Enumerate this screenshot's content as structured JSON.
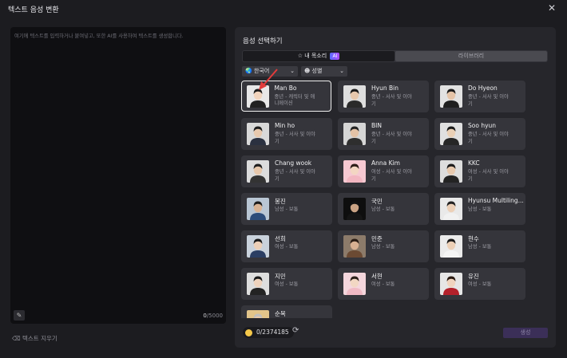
{
  "window": {
    "title": "텍스트 음성 변환",
    "close_icon": "close-icon"
  },
  "editor": {
    "placeholder": "여기에 텍스트를 입력하거나 붙여넣고, 또한 AI를 사용하여 텍스트를 생성합니다.",
    "count_current": "0",
    "count_max": "/5000",
    "clear_label": "텍스트 지우기"
  },
  "voice_panel": {
    "title": "음성 선택하기",
    "tabs": [
      {
        "label": "내 목소리",
        "badge": "AI"
      },
      {
        "label": "라이브러리"
      }
    ],
    "filters": {
      "language": "한국어",
      "gender": "성별"
    },
    "voices": [
      {
        "name": "Man Bo",
        "desc": "중년 - 캐릭터 및 애니메이션",
        "selected": true,
        "skin": "#f1d4bd",
        "hair": "#1c1c1c",
        "cloth": "#222222",
        "bg": "#e8e8e8"
      },
      {
        "name": "Hyun Bin",
        "desc": "중년 - 서사 및 이야기",
        "skin": "#e7c8ad",
        "hair": "#1a1a1a",
        "cloth": "#2a2a2a",
        "bg": "#dedede"
      },
      {
        "name": "Do Hyeon",
        "desc": "중년 - 서사 및 이야기",
        "skin": "#e5c4a8",
        "hair": "#1b1b1b",
        "cloth": "#1f1f1f",
        "bg": "#e2e2e2"
      },
      {
        "name": "Min ho",
        "desc": "중년 - 서사 및 이야기",
        "skin": "#e8c9ae",
        "hair": "#1d1d1d",
        "cloth": "#2b3140",
        "bg": "#d9d9d9"
      },
      {
        "name": "BIN",
        "desc": "중년 - 서사 및 이야기",
        "skin": "#e3c2a6",
        "hair": "#222222",
        "cloth": "#2e2e2e",
        "bg": "#d5d5d5"
      },
      {
        "name": "Soo hyun",
        "desc": "중년 - 서사 및 이야기",
        "skin": "#ead0b6",
        "hair": "#1a1a1a",
        "cloth": "#262626",
        "bg": "#e0e0e0"
      },
      {
        "name": "Chang wook",
        "desc": "중년 - 서사 및 이야기",
        "skin": "#e6c7ab",
        "hair": "#1e1e1e",
        "cloth": "#333333",
        "bg": "#dcdcdc"
      },
      {
        "name": "Anna Kim",
        "desc": "여성 - 서사 및 이야기",
        "skin": "#f3d6c2",
        "hair": "#2b1d17",
        "cloth": "#f2b6c1",
        "bg": "#f6c9d2"
      },
      {
        "name": "KKC",
        "desc": "여성 - 서사 및 이야기",
        "skin": "#e7c9ae",
        "hair": "#1b1b1b",
        "cloth": "#232323",
        "bg": "#dddddd"
      },
      {
        "name": "봉진",
        "desc": "남성 - 보통",
        "skin": "#d9b394",
        "hair": "#1c1c1c",
        "cloth": "#2d4c7a",
        "bg": "#b9c6d4"
      },
      {
        "name": "국민",
        "desc": "남성 - 보통",
        "skin": "#caa384",
        "hair": "#121212",
        "cloth": "#151515",
        "bg": "#0e0e0e"
      },
      {
        "name": "Hyunsu Multiling...",
        "desc": "남성 - 보통",
        "skin": "#ecd0b8",
        "hair": "#222222",
        "cloth": "#f1f1f1",
        "bg": "#e9e9e9"
      },
      {
        "name": "선희",
        "desc": "여성 - 보통",
        "skin": "#eccfb7",
        "hair": "#1a1a1a",
        "cloth": "#2b3e63",
        "bg": "#c9d2dc"
      },
      {
        "name": "민준",
        "desc": "남성 - 보통",
        "skin": "#d8b192",
        "hair": "#2a1d15",
        "cloth": "#6b4a33",
        "bg": "#8c7b6a"
      },
      {
        "name": "현수",
        "desc": "남성 - 보통",
        "skin": "#ecd0b7",
        "hair": "#1b1b1b",
        "cloth": "#f4f4f4",
        "bg": "#ebebeb"
      },
      {
        "name": "지민",
        "desc": "여성 - 보통",
        "skin": "#efd3bd",
        "hair": "#1a1a1a",
        "cloth": "#232323",
        "bg": "#dedede"
      },
      {
        "name": "서현",
        "desc": "여성 - 보통",
        "skin": "#f2d7c3",
        "hair": "#2b1f19",
        "cloth": "#f0b9c4",
        "bg": "#f4d6dc"
      },
      {
        "name": "유진",
        "desc": "여성 - 보통",
        "skin": "#f0d4bf",
        "hair": "#2a1a12",
        "cloth": "#b3212b",
        "bg": "#e6e6e6"
      },
      {
        "name": "순복",
        "desc": "",
        "skin": "#e7c7a8",
        "hair": "#bfbfbf",
        "cloth": "#6a4a2e",
        "bg": "#e2c48a"
      }
    ]
  },
  "footer": {
    "credits": "0/2374185",
    "generate_label": "생성"
  },
  "colors": {
    "accent": "#6e4bd8",
    "selected_border": "#f0f0f0",
    "arrow": "#e23b3b"
  }
}
